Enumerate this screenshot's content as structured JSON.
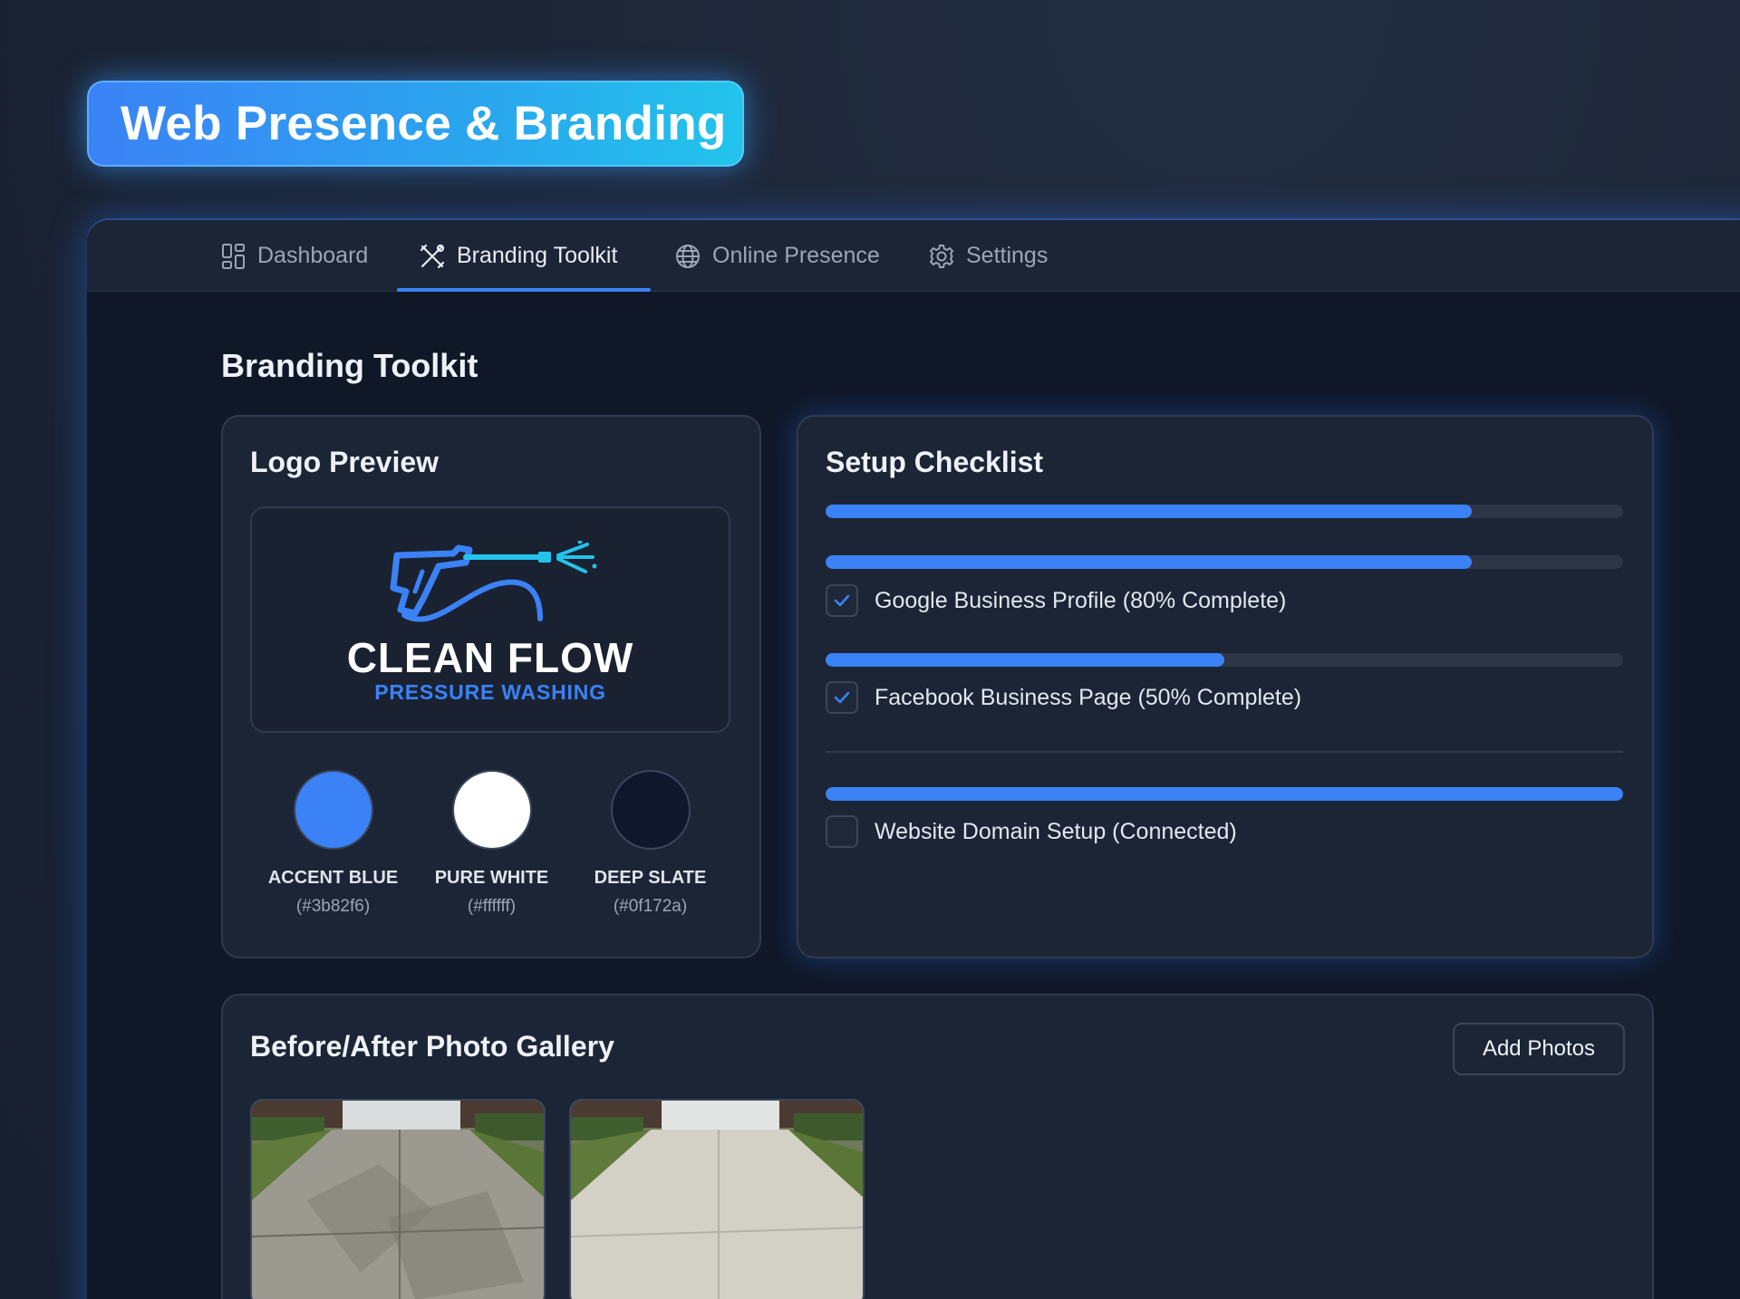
{
  "header": {
    "title": "Web Presence & Branding"
  },
  "tabs": [
    {
      "label": "Dashboard",
      "icon": "grid-icon",
      "active": false
    },
    {
      "label": "Branding Toolkit",
      "icon": "tools-icon",
      "active": true
    },
    {
      "label": "Online Presence",
      "icon": "globe-icon",
      "active": false
    },
    {
      "label": "Settings",
      "icon": "gear-icon",
      "active": false
    }
  ],
  "page": {
    "title": "Branding Toolkit"
  },
  "logo_preview": {
    "title": "Logo Preview",
    "brand_name": "CLEAN FLOW",
    "brand_tagline": "PRESSURE WASHING",
    "swatches": [
      {
        "name": "ACCENT BLUE",
        "hex": "(#3b82f6)",
        "color": "#3b82f6"
      },
      {
        "name": "PURE WHITE",
        "hex": "(#ffffff)",
        "color": "#ffffff"
      },
      {
        "name": "DEEP SLATE",
        "hex": "(#0f172a)",
        "color": "#0f172a"
      }
    ]
  },
  "checklist": {
    "title": "Setup Checklist",
    "overall_progress": 0.81,
    "items": [
      {
        "label": "Google Business Profile (80% Complete)",
        "progress": 0.81,
        "checked": true
      },
      {
        "label": "Facebook Business Page (50% Complete)",
        "progress": 0.5,
        "checked": true
      },
      {
        "label": "Website Domain Setup (Connected)",
        "progress": 1.0,
        "checked": false
      }
    ]
  },
  "gallery": {
    "title": "Before/After Photo Gallery",
    "add_button": "Add Photos",
    "photos": [
      {
        "kind": "before-driveway-photo"
      },
      {
        "kind": "after-driveway-photo"
      }
    ]
  },
  "colors": {
    "accent": "#3b82f6",
    "panel": "#101828",
    "card": "#1c2536"
  }
}
